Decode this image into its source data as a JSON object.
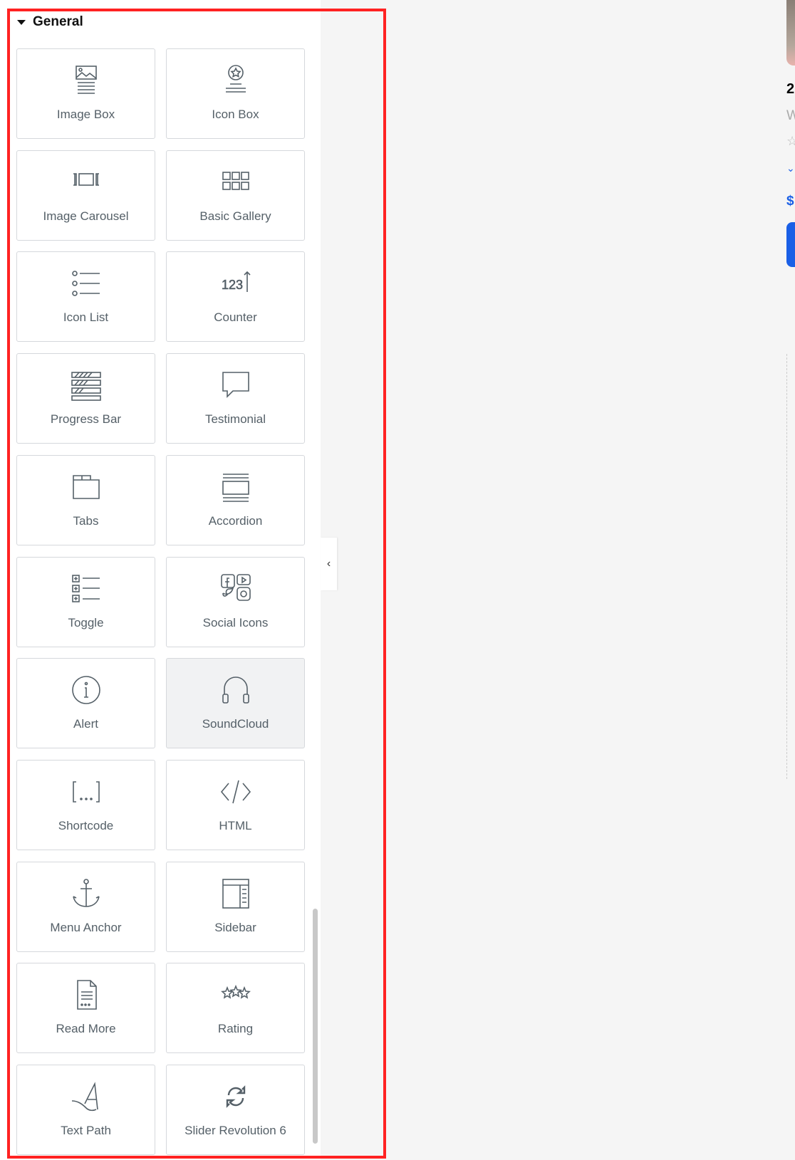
{
  "section": {
    "title": "General"
  },
  "widgets": [
    {
      "label": "Image Box",
      "icon": "image-box-icon"
    },
    {
      "label": "Icon Box",
      "icon": "icon-box-icon"
    },
    {
      "label": "Image Carousel",
      "icon": "image-carousel-icon"
    },
    {
      "label": "Basic Gallery",
      "icon": "gallery-icon"
    },
    {
      "label": "Icon List",
      "icon": "icon-list-icon"
    },
    {
      "label": "Counter",
      "icon": "counter-icon"
    },
    {
      "label": "Progress Bar",
      "icon": "progress-bar-icon"
    },
    {
      "label": "Testimonial",
      "icon": "testimonial-icon"
    },
    {
      "label": "Tabs",
      "icon": "tabs-icon"
    },
    {
      "label": "Accordion",
      "icon": "accordion-icon"
    },
    {
      "label": "Toggle",
      "icon": "toggle-icon"
    },
    {
      "label": "Social Icons",
      "icon": "social-icons-icon"
    },
    {
      "label": "Alert",
      "icon": "alert-icon"
    },
    {
      "label": "SoundCloud",
      "icon": "soundcloud-icon"
    },
    {
      "label": "Shortcode",
      "icon": "shortcode-icon"
    },
    {
      "label": "HTML",
      "icon": "html-icon"
    },
    {
      "label": "Menu Anchor",
      "icon": "anchor-icon"
    },
    {
      "label": "Sidebar",
      "icon": "sidebar-icon"
    },
    {
      "label": "Read More",
      "icon": "read-more-icon"
    },
    {
      "label": "Rating",
      "icon": "rating-icon"
    },
    {
      "label": "Text Path",
      "icon": "text-path-icon"
    },
    {
      "label": "Slider Revolution 6",
      "icon": "slider-revolution-icon"
    }
  ],
  "hovered": "SoundCloud",
  "preview": {
    "heading": "2",
    "subtitle": "W",
    "price": "$"
  },
  "colors": {
    "highlight": "#ff2222",
    "accent": "#1a5fe6"
  }
}
